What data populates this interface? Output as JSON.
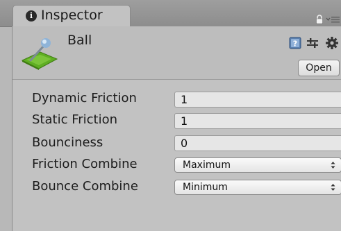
{
  "tab": {
    "title": "Inspector",
    "info_icon_glyph": "i"
  },
  "header": {
    "object_name": "Ball",
    "open_button": "Open",
    "icons": [
      "physic-material-icon",
      "help-icon",
      "preset-icon",
      "gear-icon"
    ]
  },
  "properties": [
    {
      "label": "Dynamic Friction",
      "type": "float",
      "value": "1"
    },
    {
      "label": "Static Friction",
      "type": "float",
      "value": "1"
    },
    {
      "label": "Bounciness",
      "type": "float",
      "value": "0"
    },
    {
      "label": "Friction Combine",
      "type": "enum",
      "value": "Maximum"
    },
    {
      "label": "Bounce Combine",
      "type": "enum",
      "value": "Minimum"
    }
  ],
  "colors": {
    "panel_bg": "#c2c2c2",
    "tabbar_bg": "#8d8d8d",
    "field_bg": "#e6e6e6",
    "icon_green": "#6fbf2a"
  }
}
